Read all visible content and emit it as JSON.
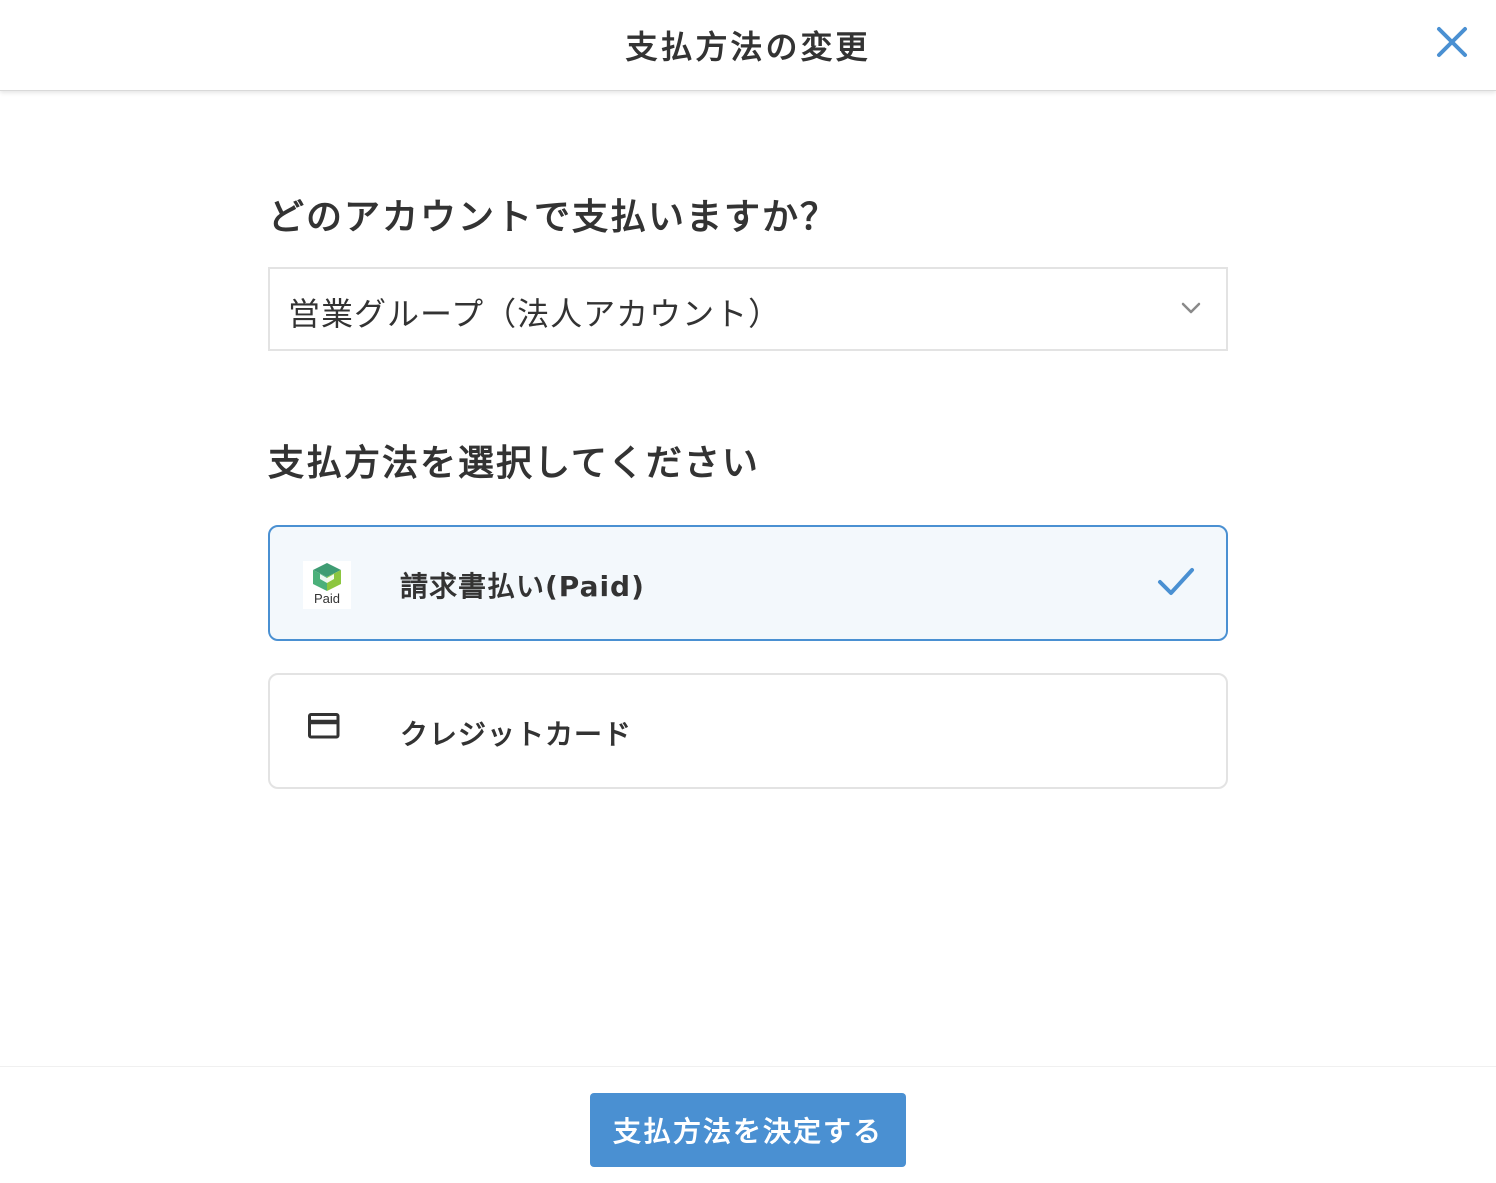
{
  "header": {
    "title": "支払方法の変更",
    "close_icon": "close-icon"
  },
  "account_section": {
    "heading": "どのアカウントで支払いますか？",
    "selected_account": "営業グループ（法人アカウント）",
    "dropdown_icon": "chevron-down-icon"
  },
  "method_section": {
    "heading": "支払方法を選択してください",
    "options": [
      {
        "label": "請求書払い(Paid)",
        "icon": "paid-logo-icon",
        "logo_text": "Paid",
        "selected": true
      },
      {
        "label": "クレジットカード",
        "icon": "credit-card-icon",
        "selected": false
      }
    ]
  },
  "footer": {
    "submit_label": "支払方法を決定する"
  },
  "colors": {
    "accent": "#4a90d2",
    "selected_background": "#f3f8fc",
    "text": "#333333",
    "border": "#e3e3e3"
  }
}
